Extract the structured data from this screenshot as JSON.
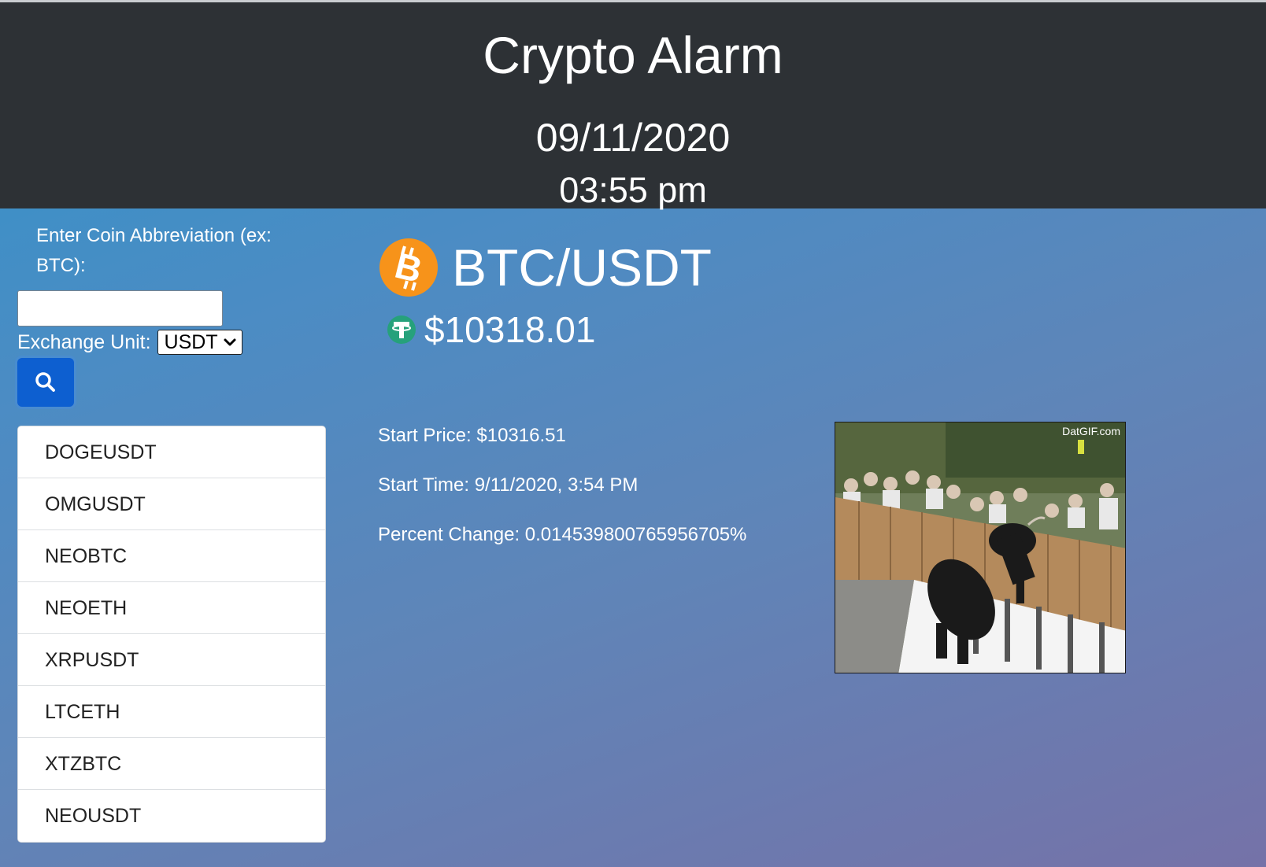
{
  "header": {
    "title": "Crypto Alarm",
    "date": "09/11/2020",
    "time": "03:55 pm"
  },
  "sidebar": {
    "prompt": "Enter Coin Abbreviation (ex: BTC):",
    "input_value": "",
    "exchange_label": "Exchange Unit:",
    "exchange_selected": "USDT",
    "search_icon": "search-icon",
    "coins": [
      "DOGEUSDT",
      "OMGUSDT",
      "NEOBTC",
      "NEOETH",
      "XRPUSDT",
      "LTCETH",
      "XTZBTC",
      "NEOUSDT"
    ]
  },
  "main": {
    "pair": "BTC/USDT",
    "coin_icon": "bitcoin-icon",
    "unit_icon": "tether-icon",
    "price": "$10318.01",
    "start_price": "Start Price: $10316.51",
    "start_time": "Start Time: 9/11/2020, 3:54 PM",
    "percent_change": "Percent Change: 0.014539800765956705%",
    "gif_watermark": "DatGIF.com"
  },
  "colors": {
    "header_bg": "#2d3135",
    "button_bg": "#0d5fd0",
    "bitcoin_orange": "#f7931a",
    "tether_green": "#26a17b"
  }
}
